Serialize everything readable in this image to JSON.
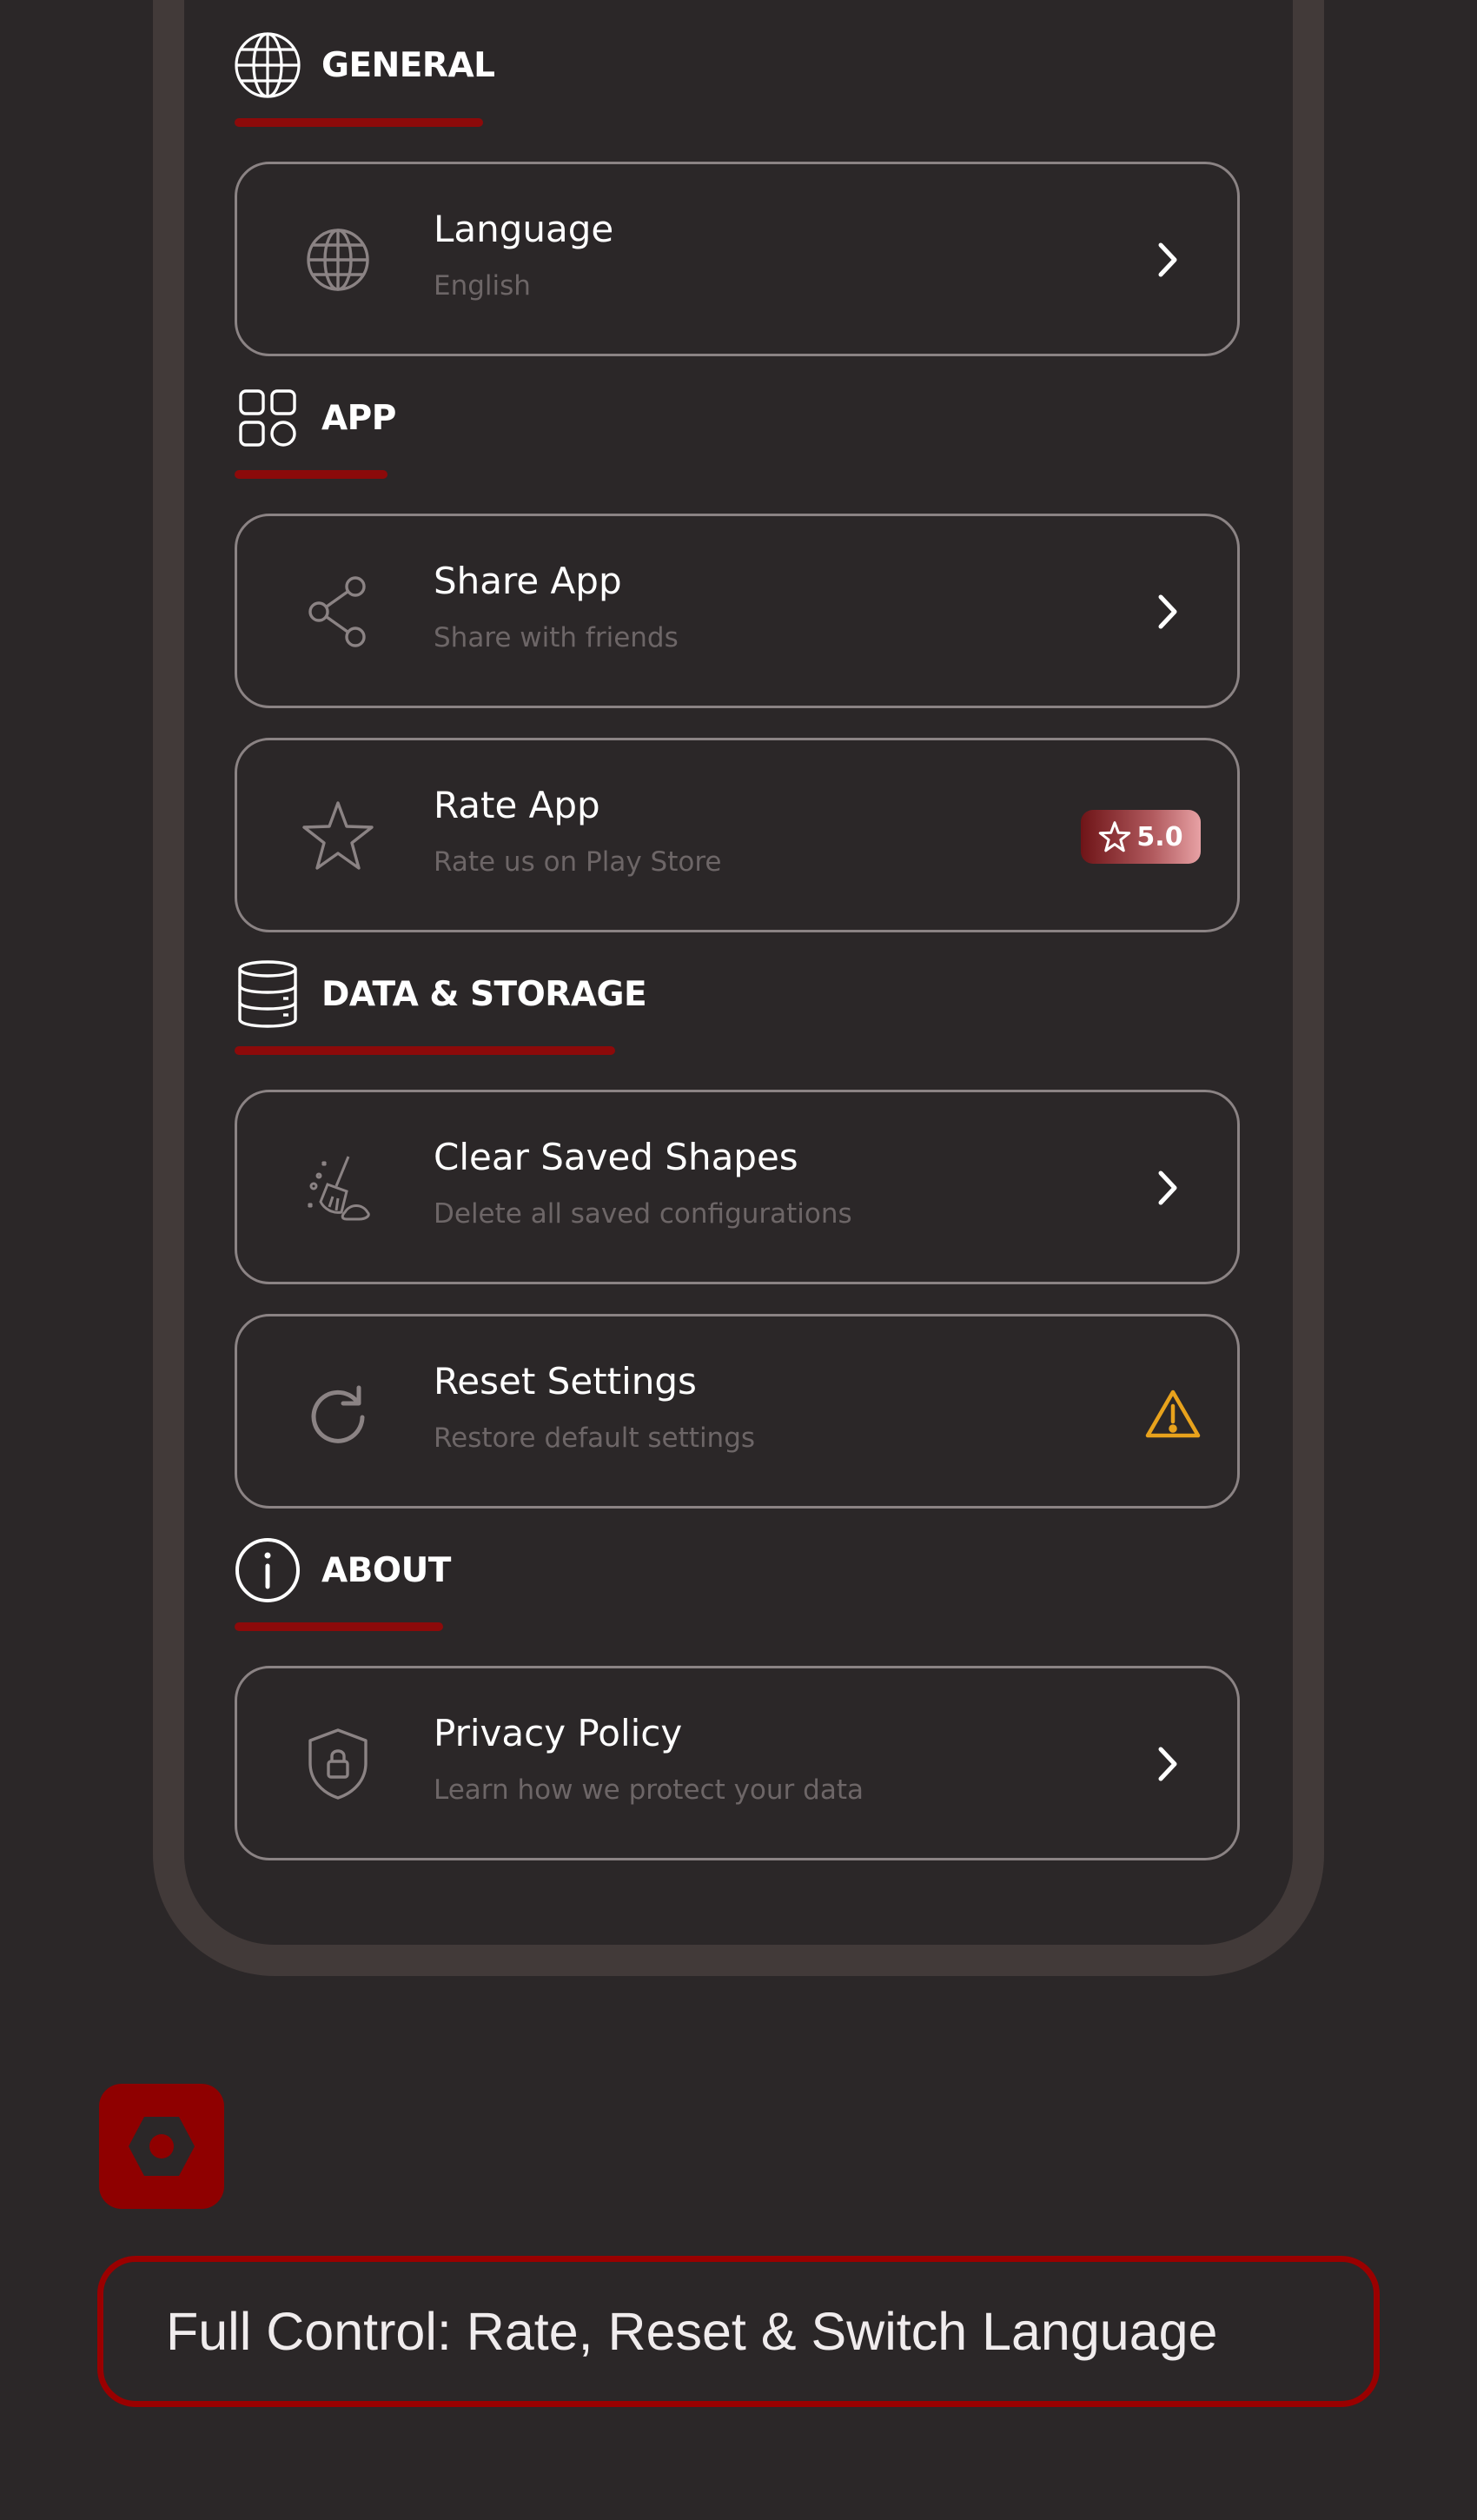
{
  "colors": {
    "background": "#2b2728",
    "frame": "#423a39",
    "accent": "#8c0a0a",
    "card_border": "#8b8384",
    "subtitle": "#6d6667",
    "warning": "#e8a21c"
  },
  "sections": {
    "general": {
      "title": "GENERAL",
      "icon": "globe-icon",
      "items": [
        {
          "title": "Language",
          "subtitle": "English",
          "icon": "globe-icon",
          "trailing": "chevron-right-icon"
        }
      ]
    },
    "app": {
      "title": "APP",
      "icon": "apps-grid-icon",
      "items": [
        {
          "title": "Share App",
          "subtitle": "Share with friends",
          "icon": "share-icon",
          "trailing": "chevron-right-icon"
        },
        {
          "title": "Rate App",
          "subtitle": "Rate us on Play Store",
          "icon": "star-icon",
          "trailing": "rating-badge",
          "badge": "5.0"
        }
      ]
    },
    "data_storage": {
      "title": "DATA & STORAGE",
      "icon": "database-icon",
      "items": [
        {
          "title": "Clear Saved Shapes",
          "subtitle": "Delete all saved configurations",
          "icon": "broom-icon",
          "trailing": "chevron-right-icon"
        },
        {
          "title": "Reset Settings",
          "subtitle": "Restore default settings",
          "icon": "refresh-icon",
          "trailing": "warning-icon"
        }
      ]
    },
    "about": {
      "title": "ABOUT",
      "icon": "info-icon",
      "items": [
        {
          "title": "Privacy Policy",
          "subtitle": "Learn how we protect your data",
          "icon": "shield-lock-icon",
          "trailing": "chevron-right-icon"
        }
      ]
    }
  },
  "fab": {
    "icon": "settings-hexagon-icon"
  },
  "caption": {
    "text": "Full Control: Rate, Reset & Switch Language"
  }
}
